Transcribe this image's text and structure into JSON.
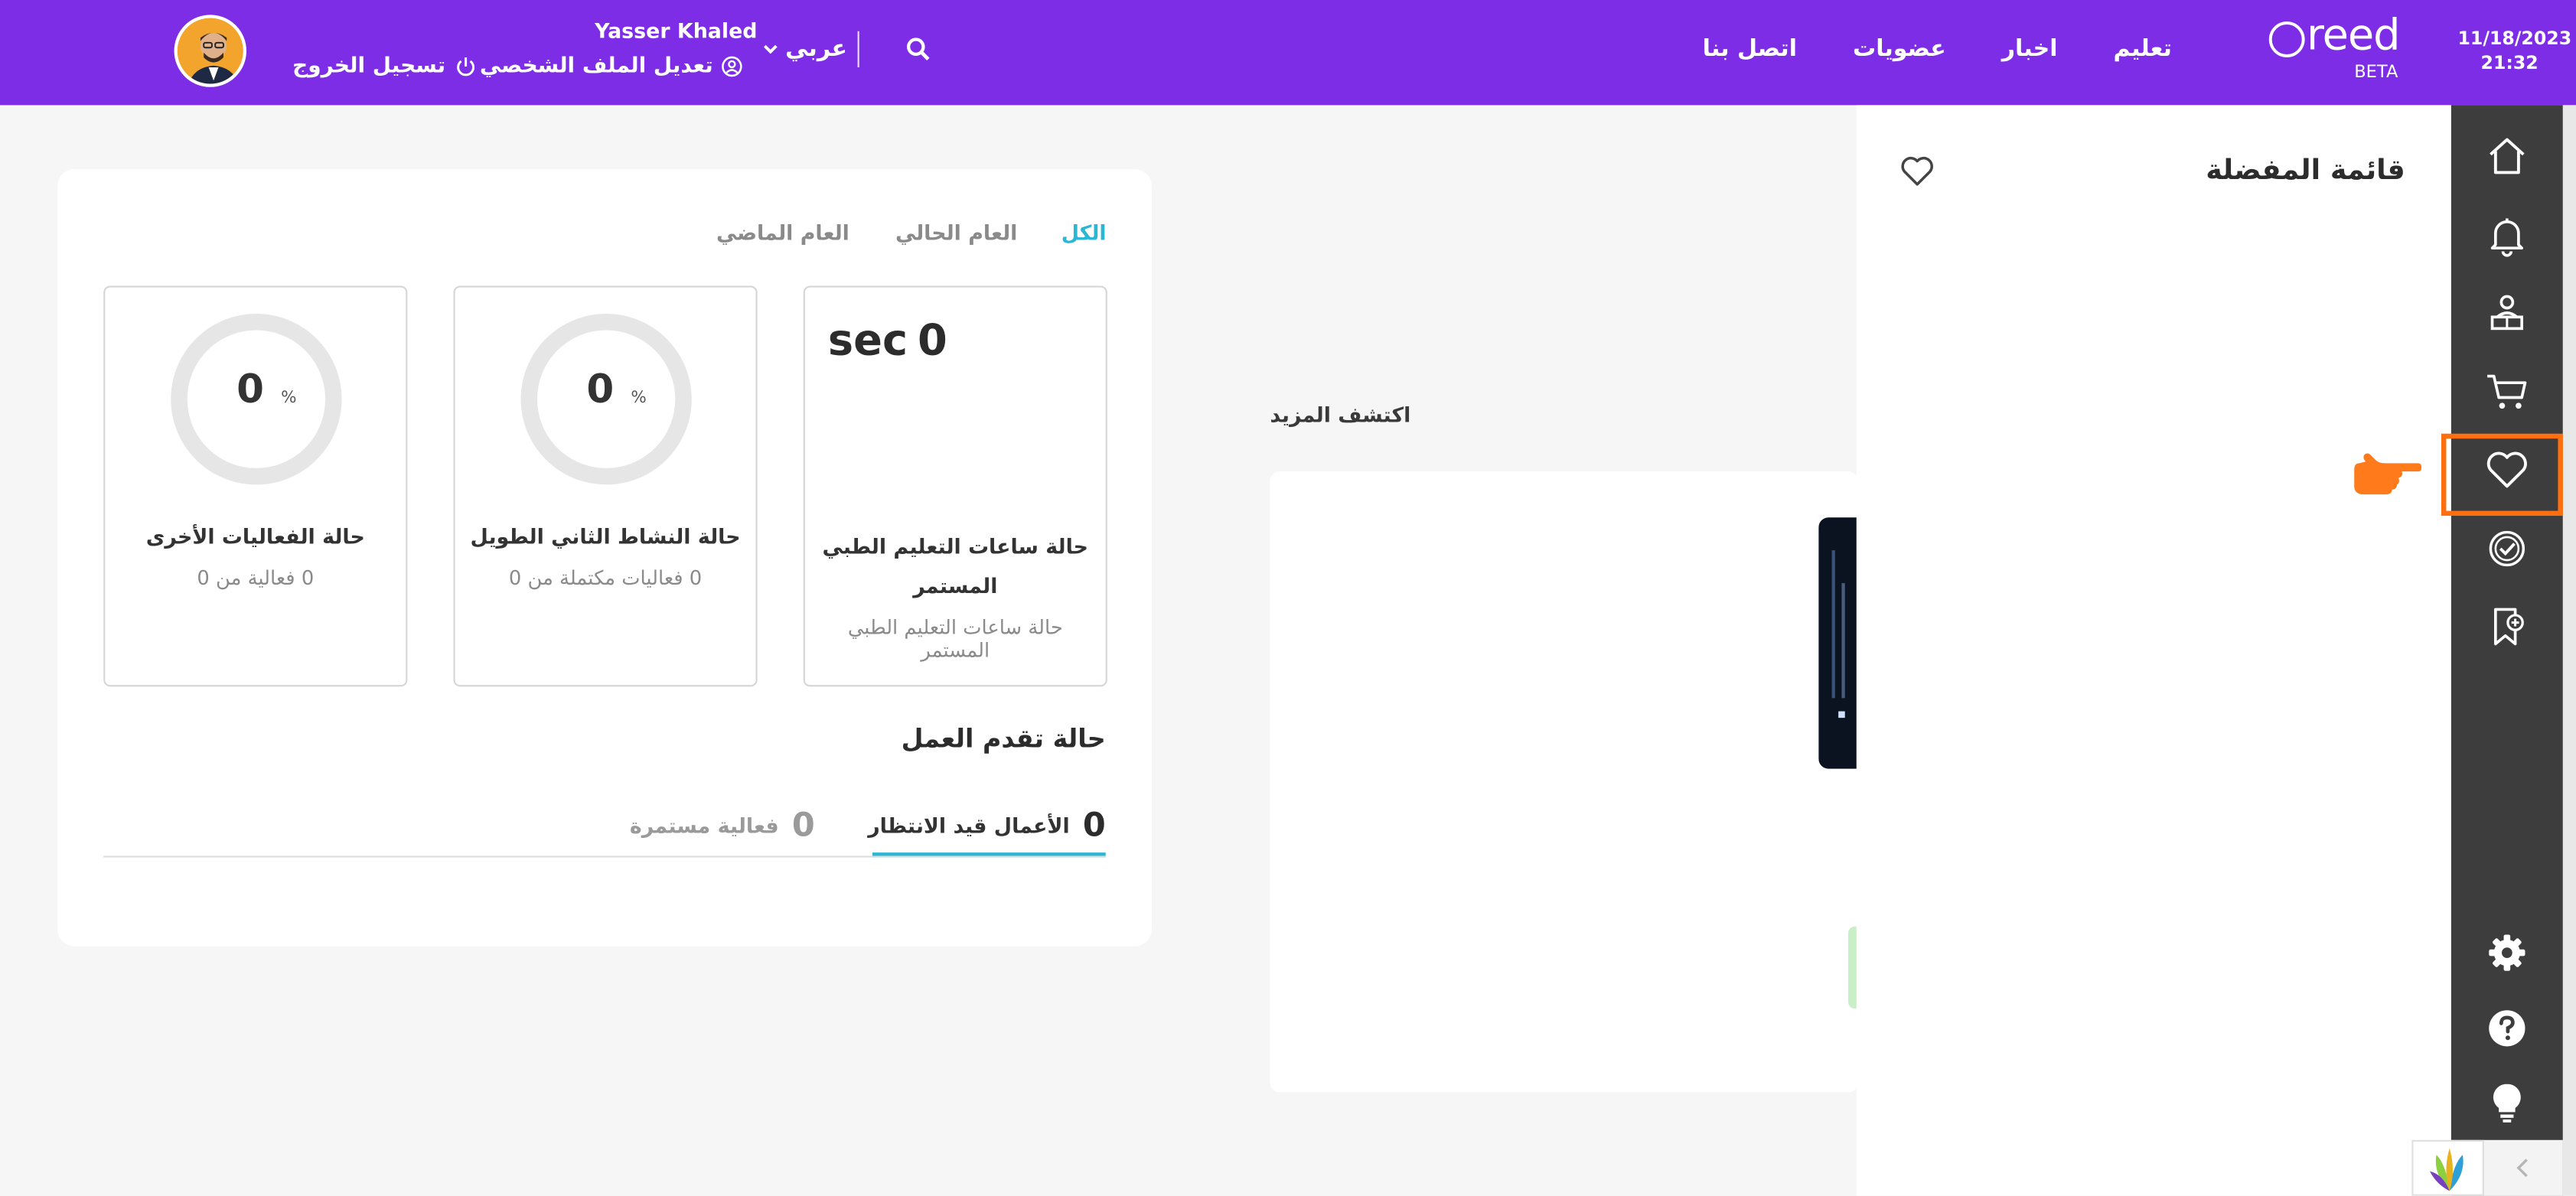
{
  "topbar": {
    "date": "11/18/2023",
    "time": "21:32",
    "brand": "reed",
    "brand_tag": "BETA",
    "nav": [
      "تعليم",
      "اخبار",
      "عضويات",
      "اتصل بنا"
    ],
    "language": "عربي",
    "user_name": "Yasser Khaled",
    "edit_profile": "تعديل الملف الشخصي",
    "logout": "تسجيل الخروج",
    "color": "#7d2de6"
  },
  "favorites": {
    "title": "قائمة المفضلة"
  },
  "dashboard": {
    "filters": [
      "الكل",
      "العام الحالي",
      "العام الماضي"
    ],
    "active_filter_color": "#2bb6d4",
    "cards": [
      {
        "value": "0",
        "unit": "sec",
        "title": "حالة ساعات التعليم الطبي المستمر",
        "subtitle": "حالة ساعات التعليم الطبي المستمر"
      },
      {
        "value": "0",
        "unit": "%",
        "title": "حالة النشاط الثاني الطويل",
        "subtitle": "0 فعاليات مكتملة من 0"
      },
      {
        "value": "0",
        "unit": "%",
        "title": "حالة الفعاليات الأخرى",
        "subtitle": "0 فعالية من 0"
      }
    ],
    "progress_title": "حالة تقدم العمل",
    "progress_tabs": [
      {
        "count": "0",
        "label": "الأعمال قيد الانتظار"
      },
      {
        "count": "0",
        "label": "فعالية مستمرة"
      }
    ]
  },
  "discover": {
    "label": "اكتشف المزيد"
  },
  "rail": {
    "icons": [
      "home-icon",
      "bell-icon",
      "learner-icon",
      "cart-icon",
      "heart-icon",
      "badge-check-icon",
      "bookmark-add-icon",
      "gear-icon",
      "help-icon",
      "lightbulb-icon"
    ],
    "highlight_color": "#ff6f0f"
  }
}
